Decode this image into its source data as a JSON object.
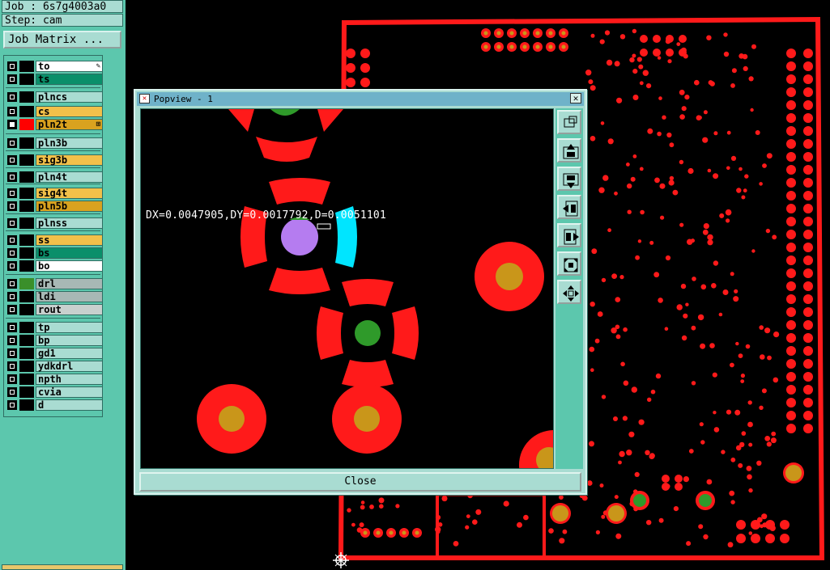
{
  "header": {
    "job": "Job : 6s7g4003a0",
    "step": "Step: cam"
  },
  "job_matrix_label": "Job Matrix ...",
  "layers": [
    {
      "name": "to",
      "bg": "#ffffff",
      "swatch": "#000000",
      "checked": false,
      "mark": "pencil-icon"
    },
    {
      "name": "ts",
      "bg": "#0a8f6a",
      "swatch": "#000000",
      "checked": false
    },
    {
      "name": "plncs",
      "bg": "#a9dcd2",
      "swatch": "#000000",
      "checked": false
    },
    {
      "name": "cs",
      "bg": "#f2c04a",
      "swatch": "#000000",
      "checked": false
    },
    {
      "name": "pln2t",
      "bg": "#d9a21f",
      "swatch": "#ff0000",
      "checked": true,
      "mark": "resize-icon"
    },
    {
      "name": "pln3b",
      "bg": "#a9dcd2",
      "swatch": "#000000",
      "checked": false
    },
    {
      "name": "sig3b",
      "bg": "#f2c04a",
      "swatch": "#000000",
      "checked": false
    },
    {
      "name": "pln4t",
      "bg": "#a9dcd2",
      "swatch": "#000000",
      "checked": false
    },
    {
      "name": "sig4t",
      "bg": "#f2c04a",
      "swatch": "#000000",
      "checked": false
    },
    {
      "name": "pln5b",
      "bg": "#d9a21f",
      "swatch": "#000000",
      "checked": false
    },
    {
      "name": "plnss",
      "bg": "#a9dcd2",
      "swatch": "#000000",
      "checked": false
    },
    {
      "name": "ss",
      "bg": "#f2c04a",
      "swatch": "#000000",
      "checked": false
    },
    {
      "name": "bs",
      "bg": "#0a8f6a",
      "swatch": "#000000",
      "checked": false
    },
    {
      "name": "bo",
      "bg": "#ffffff",
      "swatch": "#000000",
      "checked": false
    },
    {
      "name": "drl",
      "bg": "#a8b8b5",
      "swatch": "#3a8f2a",
      "checked": false
    },
    {
      "name": "ldi",
      "bg": "#a8b8b5",
      "swatch": "#000000",
      "checked": false
    },
    {
      "name": "rout",
      "bg": "#c8d0ce",
      "swatch": "#000000",
      "checked": false
    },
    {
      "name": "tp",
      "bg": "#a9dcd2",
      "swatch": "#000000",
      "checked": false
    },
    {
      "name": "bp",
      "bg": "#a9dcd2",
      "swatch": "#000000",
      "checked": false
    },
    {
      "name": "gd1",
      "bg": "#a9dcd2",
      "swatch": "#000000",
      "checked": false
    },
    {
      "name": "ydkdrl",
      "bg": "#a9dcd2",
      "swatch": "#000000",
      "checked": false
    },
    {
      "name": "npth",
      "bg": "#a9dcd2",
      "swatch": "#000000",
      "checked": false
    },
    {
      "name": "cvia",
      "bg": "#a9dcd2",
      "swatch": "#000000",
      "checked": false
    },
    {
      "name": "d",
      "bg": "#a9dcd2",
      "swatch": "#000000",
      "checked": false
    }
  ],
  "popview": {
    "title": "Popview - 1",
    "measurement": "DX=0.0047905,DY=0.0017792,D=0.0051101",
    "close_label": "Close",
    "tools": [
      "zoom-window-icon",
      "pan-up-icon",
      "pan-down-icon",
      "pan-left-icon",
      "pan-right-icon",
      "zoom-fit-icon",
      "zoom-home-icon"
    ]
  },
  "colors": {
    "panel": "#5cc7ad",
    "button": "#a9dcd2",
    "board_outline": "#ff1a1a",
    "pad": "#ff1a1a",
    "drill": "#c9961a",
    "via_green": "#2f9a2a",
    "highlight": "#b57cf0",
    "cyan": "#00e5ff"
  }
}
